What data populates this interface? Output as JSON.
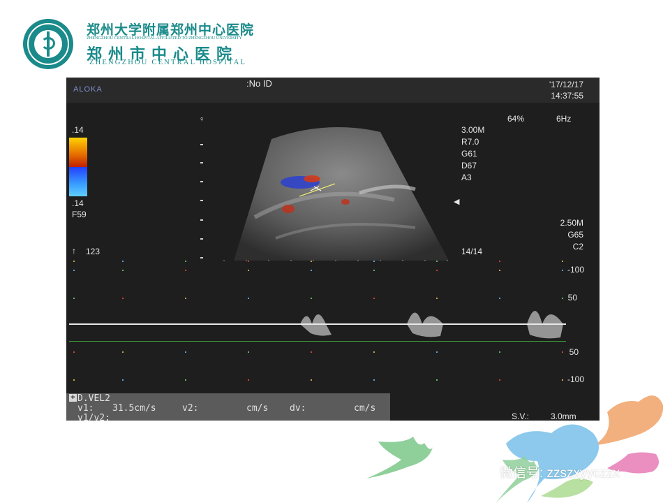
{
  "header": {
    "hospital_cn_line1": "郑州大学附属郑州中心医院",
    "hospital_en_line1": "ZHENGZHOU CENTRAL HOSPITAL AFFILIATED TO ZHENGZHOU UNIVERSITY",
    "hospital_cn_line2": "郑州市中心医院",
    "hospital_en_line2": "ZHENGZHOU CENTRAL HOSPITAL",
    "logo_color": "#1a8a8a"
  },
  "ultrasound": {
    "brand": "ALOKA",
    "patient_id": ":No ID",
    "date": "'17/12/17",
    "time": "14:37:55",
    "power": "64%",
    "frame_rate": "6Hz",
    "color_scale_top": ".14",
    "color_scale_bottom": ".14",
    "filter": "F59",
    "params_b": [
      "3.00M",
      "R7.0",
      "G61",
      "D67",
      "A3"
    ],
    "params_doppler": [
      "2.50M",
      "G65",
      "C2"
    ],
    "frame_counter": "14/14",
    "angle": "123",
    "spectral_scale": [
      "-100",
      "50",
      "50",
      "-100"
    ],
    "measurement": {
      "title": "D.VEL2",
      "v1_label": "v1:",
      "v1_value": "31.5cm/s",
      "v2_label": "v2:",
      "v2_unit": "cm/s",
      "dv_label": "dv:",
      "dv_unit": "cm/s",
      "ratio_label": "v1/v2:"
    },
    "sample_volume": "S.V.:",
    "sample_volume_value": "3.0mm"
  },
  "footer": {
    "wechat_text": "微信号: zzszxyyczzx",
    "leaf_colors": [
      "#8fcf9a",
      "#8cc9ec",
      "#f2b07e",
      "#ea8fc0",
      "#b8e0a0"
    ]
  }
}
